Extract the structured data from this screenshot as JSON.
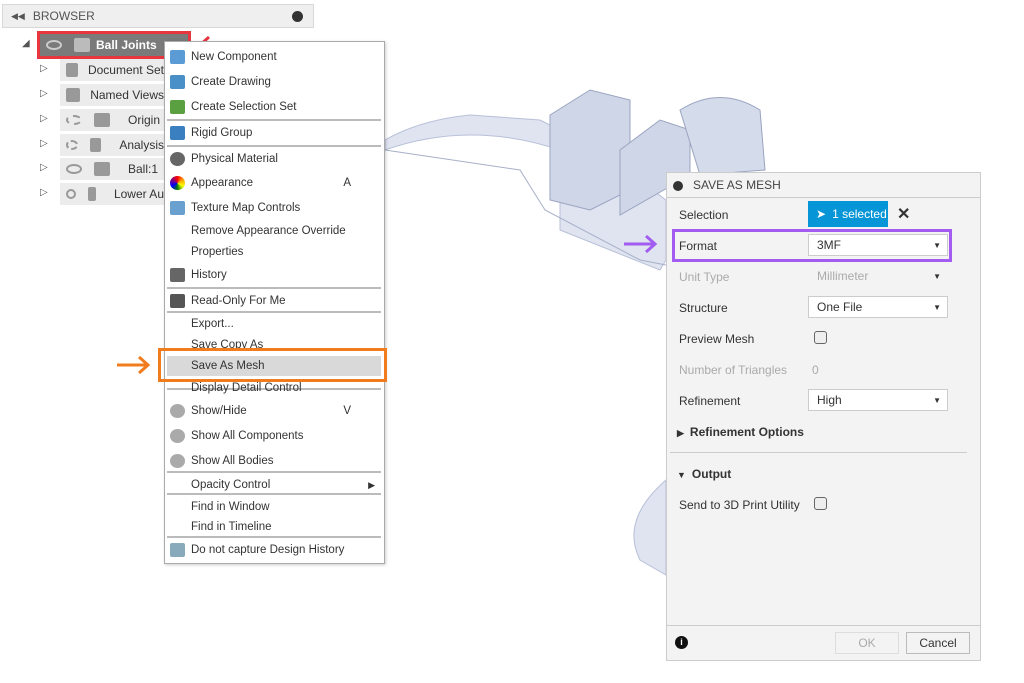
{
  "browser": {
    "title": "BROWSER",
    "root": "Ball Joints",
    "items": [
      {
        "label": "Document Set",
        "icon": "gear-icon"
      },
      {
        "label": "Named Views",
        "icon": "folder-icon"
      },
      {
        "label": "Origin",
        "icon": "folder-icon",
        "hidden": true
      },
      {
        "label": "Analysis",
        "icon": "folder-icon",
        "hidden": true
      },
      {
        "label": "Ball:1",
        "icon": "component-icon"
      },
      {
        "label": "Lower Au",
        "icon": "component-icon"
      }
    ]
  },
  "menu": {
    "items": [
      {
        "label": "New Component",
        "icon": "new-component-icon"
      },
      {
        "label": "Create Drawing",
        "icon": "create-drawing-icon"
      },
      {
        "label": "Create Selection Set",
        "icon": "selection-set-icon"
      },
      {
        "label": "Rigid Group",
        "icon": "rigid-group-icon"
      },
      {
        "label": "Physical Material",
        "icon": "physical-material-icon"
      },
      {
        "label": "Appearance",
        "icon": "appearance-icon",
        "shortcut": "A"
      },
      {
        "label": "Texture Map Controls",
        "icon": "texture-map-icon"
      },
      {
        "label": "Remove Appearance Override"
      },
      {
        "label": "Properties"
      },
      {
        "label": "History",
        "icon": "history-icon"
      },
      {
        "label": "Read-Only For Me",
        "icon": "unlock-icon"
      },
      {
        "label": "Export..."
      },
      {
        "label": "Save Copy As"
      },
      {
        "label": "Save As Mesh",
        "highlighted": true
      },
      {
        "label": "Display Detail Control"
      },
      {
        "label": "Show/Hide",
        "icon": "eye-icon",
        "shortcut": "V"
      },
      {
        "label": "Show All Components",
        "icon": "eye-icon"
      },
      {
        "label": "Show All Bodies",
        "icon": "eye-icon"
      },
      {
        "label": "Opacity Control",
        "submenu": true
      },
      {
        "label": "Find in Window"
      },
      {
        "label": "Find in Timeline"
      },
      {
        "label": "Do not capture Design History",
        "icon": "design-history-icon"
      }
    ]
  },
  "dialog": {
    "title": "SAVE AS MESH",
    "selection_label": "Selection",
    "selection_value": "1 selected",
    "format_label": "Format",
    "format_value": "3MF",
    "unit_label": "Unit Type",
    "unit_value": "Millimeter",
    "structure_label": "Structure",
    "structure_value": "One File",
    "preview_label": "Preview Mesh",
    "triangles_label": "Number of Triangles",
    "triangles_value": "0",
    "refinement_label": "Refinement",
    "refinement_value": "High",
    "refinement_options": "Refinement Options",
    "output": "Output",
    "send_label": "Send to 3D Print Utility",
    "ok": "OK",
    "cancel": "Cancel"
  },
  "colors": {
    "accent": "#0696d7",
    "highlight_red": "#e8363f",
    "highlight_orange": "#f07c1e",
    "highlight_purple": "#a35cf0"
  }
}
